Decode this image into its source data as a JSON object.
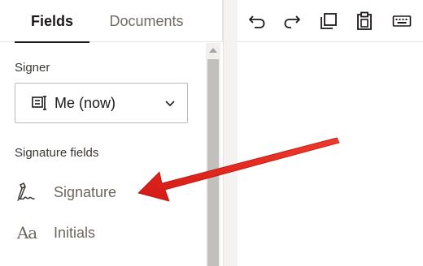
{
  "tabs": {
    "fields": "Fields",
    "documents": "Documents"
  },
  "signer": {
    "label": "Signer",
    "value": "Me (now)"
  },
  "signature_fields": {
    "label": "Signature fields",
    "items": [
      {
        "label": "Signature",
        "icon": "signature-pen-icon"
      },
      {
        "label": "Initials",
        "icon": "initials-aa-icon"
      }
    ]
  },
  "toolbar": {
    "icons": [
      "undo-icon",
      "redo-icon",
      "copy-icon",
      "paste-icon",
      "keyboard-icon"
    ]
  },
  "annotation": {
    "arrow_color": "#e8231e"
  }
}
